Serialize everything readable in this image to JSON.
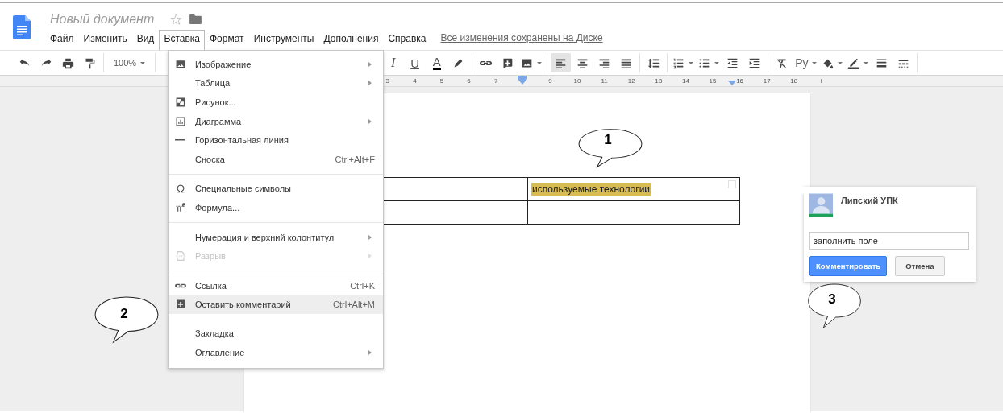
{
  "document": {
    "title": "Новый документ",
    "starred": false
  },
  "menu_bar": [
    {
      "label": "Файл",
      "selected": false
    },
    {
      "label": "Изменить",
      "selected": false
    },
    {
      "label": "Вид",
      "selected": false
    },
    {
      "label": "Вставка",
      "selected": true
    },
    {
      "label": "Формат",
      "selected": false
    },
    {
      "label": "Инструменты",
      "selected": false
    },
    {
      "label": "Дополнения",
      "selected": false
    },
    {
      "label": "Справка",
      "selected": false
    }
  ],
  "save_status": "Все изменения сохранены на Диске",
  "toolbar": {
    "groups": [
      {
        "items": [
          {
            "kind": "icon",
            "dropdown": false,
            "selected": false
          },
          {
            "kind": "icon",
            "dropdown": false,
            "selected": false
          },
          {
            "kind": "icon",
            "dropdown": false,
            "selected": false
          },
          {
            "kind": "icon",
            "dropdown": false,
            "selected": false
          }
        ]
      },
      {
        "items": [
          {
            "kind": "text",
            "label": "100%",
            "dropdown": true,
            "selected": false
          }
        ]
      },
      {
        "items": [
          {
            "kind": "text",
            "label": "I",
            "dropdown": false,
            "selected": false
          },
          {
            "kind": "text",
            "label": "U",
            "dropdown": false,
            "selected": false
          },
          {
            "kind": "text",
            "label": "A",
            "dropdown": false,
            "selected": false
          },
          {
            "kind": "icon",
            "dropdown": false,
            "selected": false
          }
        ]
      },
      {
        "items": [
          {
            "kind": "icon",
            "dropdown": false,
            "selected": false
          },
          {
            "kind": "icon",
            "dropdown": false,
            "selected": false
          },
          {
            "kind": "icon",
            "dropdown": true,
            "selected": false
          }
        ]
      },
      {
        "items": [
          {
            "kind": "icon",
            "dropdown": false,
            "selected": true
          },
          {
            "kind": "icon",
            "dropdown": false,
            "selected": false
          },
          {
            "kind": "icon",
            "dropdown": false,
            "selected": false
          },
          {
            "kind": "icon",
            "dropdown": false,
            "selected": false
          }
        ]
      },
      {
        "items": [
          {
            "kind": "icon",
            "dropdown": false,
            "selected": false
          }
        ]
      },
      {
        "items": [
          {
            "kind": "icon",
            "dropdown": true,
            "selected": false
          },
          {
            "kind": "icon",
            "dropdown": true,
            "selected": false
          },
          {
            "kind": "icon",
            "dropdown": false,
            "selected": false
          },
          {
            "kind": "icon",
            "dropdown": false,
            "selected": false
          }
        ]
      },
      {
        "items": [
          {
            "kind": "icon",
            "dropdown": false,
            "selected": false
          },
          {
            "kind": "text",
            "label": "Ру",
            "dropdown": true,
            "selected": false
          },
          {
            "kind": "icon",
            "dropdown": true,
            "selected": false
          },
          {
            "kind": "icon",
            "dropdown": true,
            "selected": false
          },
          {
            "kind": "icon",
            "dropdown": false,
            "selected": false
          },
          {
            "kind": "icon",
            "dropdown": false,
            "selected": false
          }
        ]
      }
    ]
  },
  "ruler": [
    {
      "kind": "number",
      "label": "3"
    },
    {
      "kind": "number",
      "label": "4"
    },
    {
      "kind": "number",
      "label": "5"
    },
    {
      "kind": "number",
      "label": "6"
    },
    {
      "kind": "number",
      "label": "7"
    },
    {
      "kind": "marker"
    },
    {
      "kind": "number",
      "label": "9"
    },
    {
      "kind": "number",
      "label": "10"
    },
    {
      "kind": "number",
      "label": "11"
    },
    {
      "kind": "number",
      "label": "12"
    },
    {
      "kind": "number",
      "label": "13"
    },
    {
      "kind": "number",
      "label": "14"
    },
    {
      "kind": "number",
      "label": "15"
    },
    {
      "kind": "number",
      "label": "16"
    },
    {
      "kind": "number",
      "label": "17"
    },
    {
      "kind": "number",
      "label": "18"
    }
  ],
  "insert_menu": {
    "groups": [
      {
        "rule_above": false,
        "items": [
          {
            "label": "Изображение",
            "submenu": true,
            "disabled": false,
            "selected": false
          },
          {
            "label": "Таблица",
            "submenu": true,
            "disabled": false,
            "selected": false
          },
          {
            "label": "Рисунок...",
            "submenu": false,
            "disabled": false,
            "selected": false
          },
          {
            "label": "Диаграмма",
            "submenu": true,
            "disabled": false,
            "selected": false
          },
          {
            "label": "Горизонтальная линия",
            "submenu": false,
            "disabled": false,
            "selected": false
          },
          {
            "label": "Сноска",
            "shortcut": "Ctrl+Alt+F",
            "submenu": false,
            "disabled": false,
            "selected": false
          }
        ]
      },
      {
        "rule_above": true,
        "items": [
          {
            "label": "Специальные символы",
            "submenu": false,
            "disabled": false,
            "selected": false
          },
          {
            "label": "Формула...",
            "submenu": false,
            "disabled": false,
            "selected": false
          }
        ]
      },
      {
        "rule_above": true,
        "items": [
          {
            "label": "Нумерация и верхний колонтитул",
            "submenu": true,
            "disabled": false,
            "selected": false
          },
          {
            "label": "Разрыв",
            "submenu": true,
            "disabled": true,
            "selected": false
          }
        ]
      },
      {
        "rule_above": true,
        "items": [
          {
            "label": "Ссылка",
            "shortcut": "Ctrl+K",
            "submenu": false,
            "disabled": false,
            "selected": false
          },
          {
            "label": "Оставить комментарий",
            "shortcut": "Ctrl+Alt+M",
            "submenu": false,
            "disabled": false,
            "selected": true
          }
        ]
      },
      {
        "rule_above": false,
        "items": [
          {
            "label": "Закладка",
            "submenu": false,
            "disabled": false,
            "selected": false
          },
          {
            "label": "Оглавление",
            "submenu": true,
            "disabled": false,
            "selected": false
          }
        ]
      }
    ]
  },
  "table": {
    "rows": [
      {
        "cells": [
          {
            "kind": "empty"
          },
          {
            "kind": "text",
            "text": "используемые технологии",
            "highlighted": true
          }
        ]
      },
      {
        "cells": [
          {
            "kind": "empty"
          },
          {
            "kind": "empty"
          }
        ]
      }
    ]
  },
  "callouts": [
    {
      "number": "1"
    },
    {
      "number": "2"
    },
    {
      "number": "3"
    }
  ],
  "comment": {
    "author": "Липский УПК",
    "value": "заполнить поле",
    "buttons": [
      {
        "label": "Комментировать",
        "primary": true
      },
      {
        "label": "Отмена",
        "primary": false
      }
    ]
  }
}
